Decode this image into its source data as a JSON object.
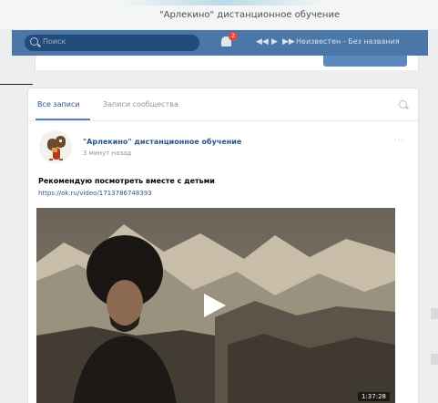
{
  "window": {
    "title": "\"Арлекино\" дистанционное обучение"
  },
  "topbar": {
    "search_placeholder": "Поиск",
    "notifications_count": "2",
    "music_title": "Неизвестен - Без названия"
  },
  "feed": {
    "tabs": [
      "Все записи",
      "Записи сообщества"
    ],
    "post": {
      "author": "\"Арлекино\" дистанционное обучение",
      "time": "3 минут назад",
      "text": "Рекомендую посмотреть вместе с детьми",
      "link": "https://ok.ru/video/1713786748393",
      "video_duration": "1:37:28"
    }
  },
  "colors": {
    "header": "#4a76a8",
    "link": "#2a5885",
    "badge": "#e64646"
  },
  "icons": [
    "search-icon",
    "bell-icon",
    "prev-icon",
    "play-icon",
    "next-icon",
    "more-icon",
    "play-overlay-icon"
  ]
}
